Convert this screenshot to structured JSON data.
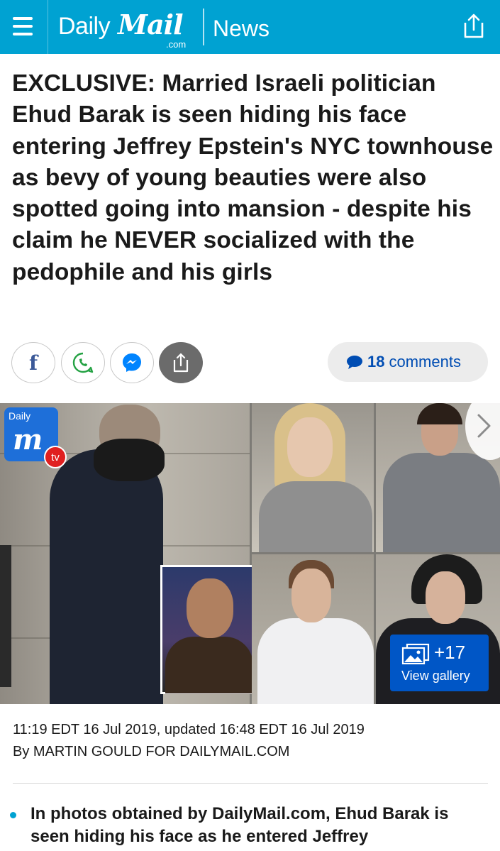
{
  "header": {
    "brand_daily": "Daily",
    "brand_mail": "Mail",
    "brand_com": ".com",
    "section": "News",
    "bg_color": "#00a2d2",
    "menu_icon": "hamburger-icon",
    "share_icon": "share-icon"
  },
  "article": {
    "headline": "EXCLUSIVE:  Married Israeli politician Ehud Barak is seen hiding his face entering Jeffrey Epstein's NYC townhouse as bevy of young beauties were also spotted going into mansion - despite his claim he NEVER socialized with the pedophile and his girls",
    "dateline": "11:19 EDT 16 Jul 2019, updated 16:48 EDT 16 Jul 2019",
    "byline": "By MARTIN GOULD FOR DAILYMAIL.COM",
    "bullet_1": "In photos obtained by DailyMail.com, Ehud Barak is seen hiding his face as he entered Jeffrey"
  },
  "social": {
    "facebook_letter": "f",
    "comments_count": "18",
    "comments_label": "comments",
    "comments_color": "#004db3"
  },
  "gallery": {
    "badge_daily": "Daily",
    "badge_m": "m",
    "badge_tv": "tv",
    "more_count": "+17",
    "view_label": "View gallery",
    "button_color": "#0056c6"
  }
}
